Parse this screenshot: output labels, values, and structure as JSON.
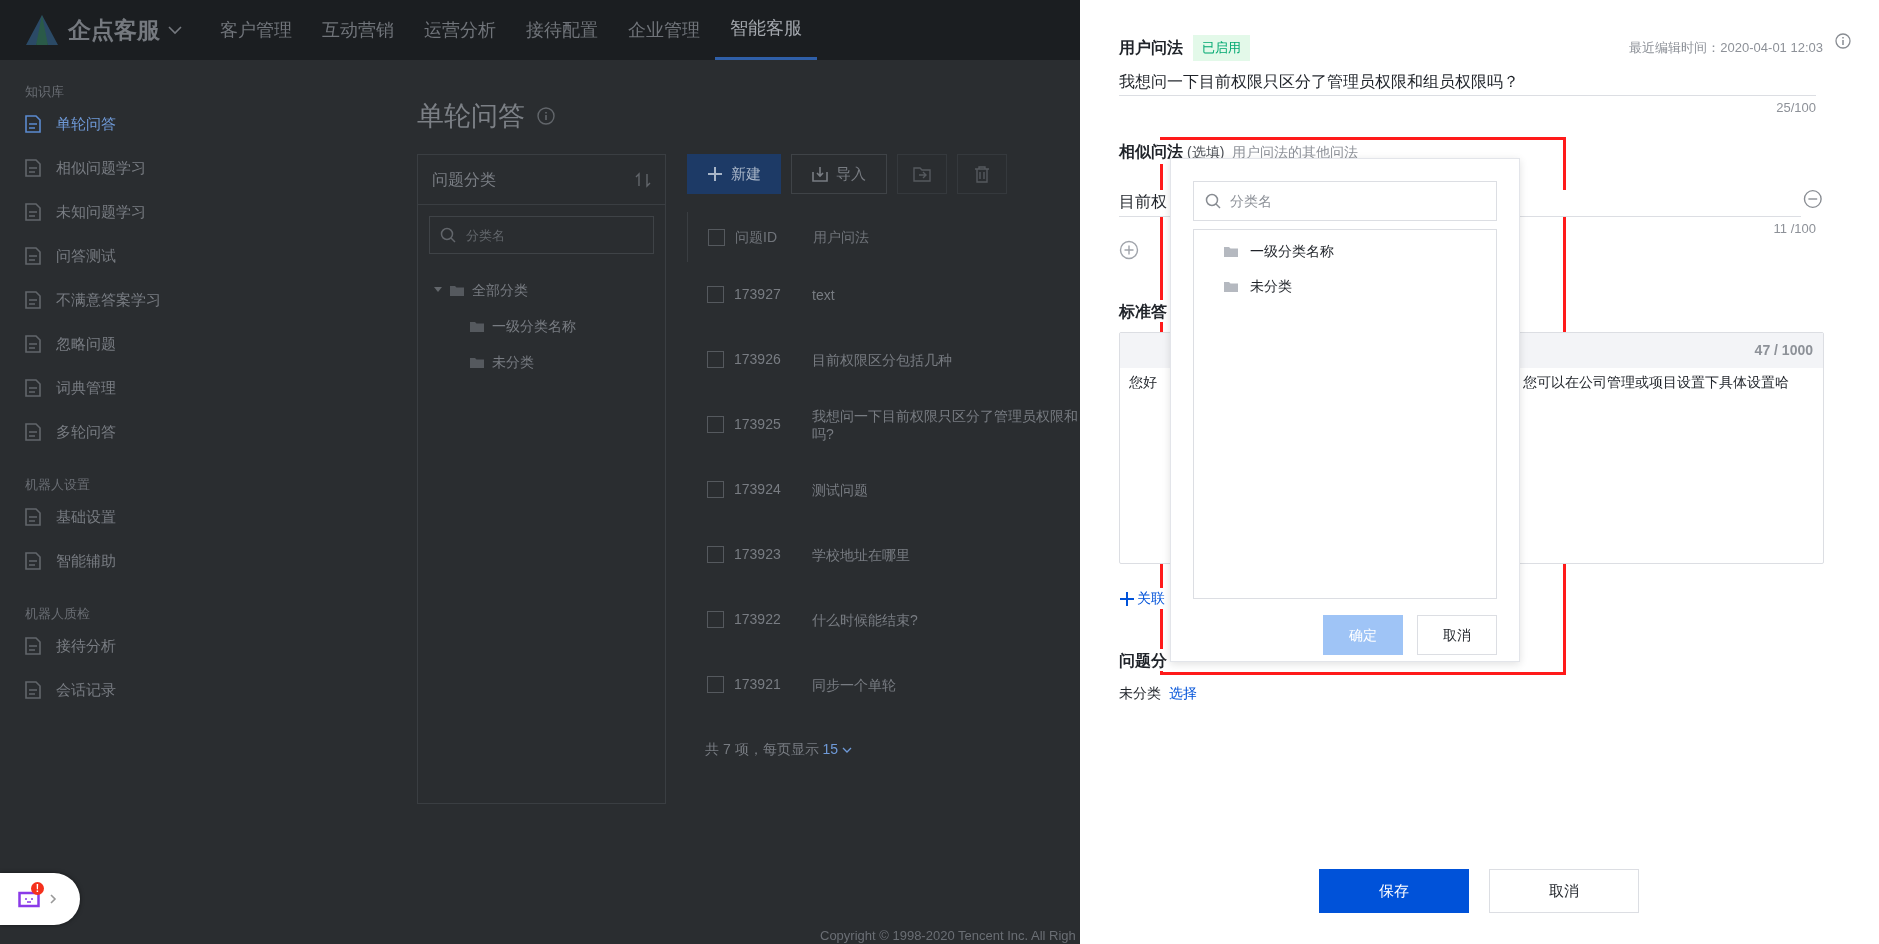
{
  "nav": {
    "logo_text": "企点客服",
    "tabs": [
      {
        "label": "客户管理",
        "selected": false
      },
      {
        "label": "互动营销",
        "selected": false
      },
      {
        "label": "运营分析",
        "selected": false
      },
      {
        "label": "接待配置",
        "selected": false
      },
      {
        "label": "企业管理",
        "selected": false
      },
      {
        "label": "智能客服",
        "selected": true
      }
    ]
  },
  "sidebar": {
    "groups": [
      {
        "title": "知识库",
        "items": [
          {
            "label": "单轮问答",
            "selected": true
          },
          {
            "label": "相似问题学习",
            "selected": false
          },
          {
            "label": "未知问题学习",
            "selected": false
          },
          {
            "label": "问答测试",
            "selected": false
          },
          {
            "label": "不满意答案学习",
            "selected": false
          },
          {
            "label": "忽略问题",
            "selected": false
          },
          {
            "label": "词典管理",
            "selected": false
          },
          {
            "label": "多轮问答",
            "selected": false
          }
        ]
      },
      {
        "title": "机器人设置",
        "items": [
          {
            "label": "基础设置",
            "selected": false
          },
          {
            "label": "智能辅助",
            "selected": false
          }
        ]
      },
      {
        "title": "机器人质检",
        "items": [
          {
            "label": "接待分析",
            "selected": false
          },
          {
            "label": "会话记录",
            "selected": false
          }
        ]
      }
    ]
  },
  "page": {
    "title": "单轮问答"
  },
  "category_panel": {
    "title": "问题分类",
    "search": {
      "placeholder": "分类名"
    },
    "tree": [
      {
        "label": "全部分类",
        "expanded": true,
        "children": [
          {
            "label": "一级分类名称"
          },
          {
            "label": "未分类"
          }
        ]
      }
    ]
  },
  "toolbar": {
    "buttons": [
      {
        "kind": "primary",
        "label": "新建"
      },
      {
        "kind": "default",
        "label": "导入"
      },
      {
        "kind": "move"
      },
      {
        "kind": "delete"
      }
    ]
  },
  "table": {
    "columns": [
      "问题ID",
      "用户问法"
    ],
    "header_checked": false,
    "rows": [
      {
        "id": "173927",
        "question": [
          "text"
        ],
        "checked": false
      },
      {
        "id": "173926",
        "question": [
          "目前权限区分包括几种"
        ],
        "checked": false
      },
      {
        "id": "173925",
        "question": [
          "我想问一下目前权限只区分了管理员权限和",
          "吗?"
        ],
        "checked": false
      },
      {
        "id": "173924",
        "question": [
          "测试问题"
        ],
        "checked": false
      },
      {
        "id": "173923",
        "question": [
          "学校地址在哪里"
        ],
        "checked": false
      },
      {
        "id": "173922",
        "question": [
          "什么时候能结束?"
        ],
        "checked": false
      },
      {
        "id": "173921",
        "question": [
          "同步一个单轮"
        ],
        "checked": false
      }
    ]
  },
  "pagination": {
    "summary": "共 7 项，每页显示",
    "page_size": "15"
  },
  "footer": {
    "copyright": "Copyright © 1998-2020 Tencent Inc. All Righ"
  },
  "bot_widget": {
    "badge": "!"
  },
  "drawer": {
    "question_label": "用户问法",
    "status": "已启用",
    "last_edited": "最近编辑时间：2020-04-01 12:03",
    "question": {
      "value": "我想问一下目前权限只区分了管理员权限和组员权限吗？",
      "counter": "25/100"
    },
    "similar": {
      "label": "相似问法",
      "optional": "(选填)",
      "hint": "用户问法的其他问法",
      "items": [
        {
          "value": "目前权",
          "counter": "11 /100"
        }
      ]
    },
    "answer": {
      "label": "标准答",
      "counter": "47 / 1000",
      "text_parts": [
        "您好",
        "您可以在公司管理或项目设置下具体设置哈"
      ]
    },
    "link": "关联",
    "category": {
      "label": "问题分",
      "value": "未分类",
      "action": "选择"
    },
    "buttons": [
      {
        "kind": "primary",
        "label": "保存"
      },
      {
        "kind": "default",
        "label": "取消"
      }
    ]
  },
  "popup": {
    "search": {
      "placeholder": "分类名"
    },
    "items": [
      {
        "label": "一级分类名称"
      },
      {
        "label": "未分类"
      }
    ],
    "buttons": [
      {
        "kind": "primary",
        "label": "确定",
        "disabled": true
      },
      {
        "kind": "default",
        "label": "取消",
        "disabled": false
      }
    ]
  }
}
